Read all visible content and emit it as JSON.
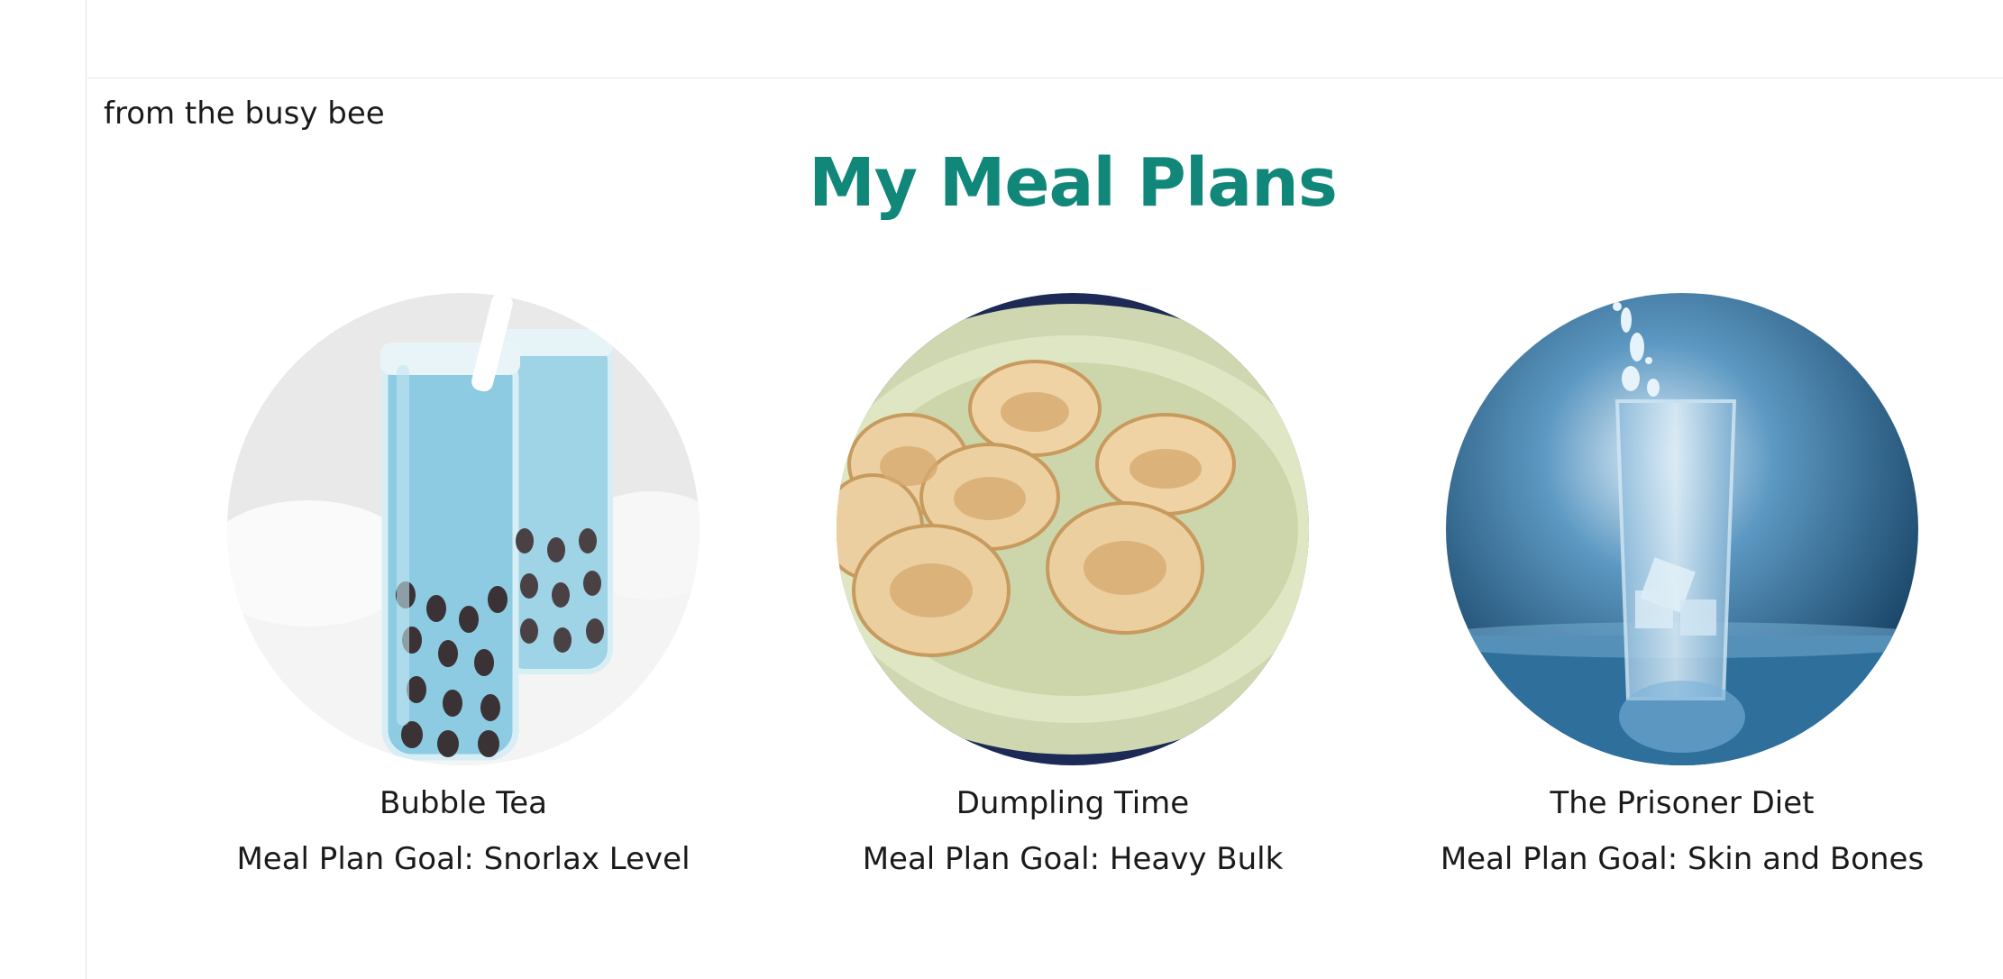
{
  "header": {
    "tagline": "from the busy bee",
    "title": "My Meal Plans"
  },
  "plans": [
    {
      "name": "Bubble Tea",
      "goal": "Meal Plan Goal: Snorlax Level",
      "image": "bubble-tea-photo"
    },
    {
      "name": "Dumpling Time",
      "goal": "Meal Plan Goal: Heavy Bulk",
      "image": "dumplings-photo"
    },
    {
      "name": "The Prisoner Diet",
      "goal": "Meal Plan Goal: Skin and Bones",
      "image": "glass-of-water-photo"
    }
  ],
  "colors": {
    "title": "#11877a",
    "text": "#1a1a1a"
  }
}
